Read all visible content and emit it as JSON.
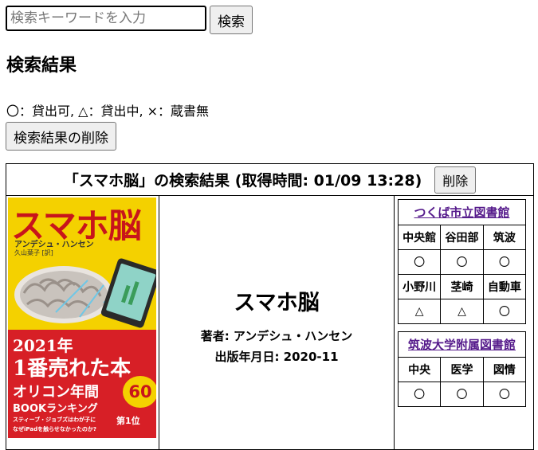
{
  "search": {
    "placeholder": "検索キーワードを入力",
    "button": "検索"
  },
  "heading": "検索結果",
  "legend": "〇：貸出可, △：貸出中, ×：蔵書無",
  "delete_all": "検索結果の削除",
  "result": {
    "header": "「スマホ脳」の検索結果 (取得時間: 01/09 13:28)",
    "delete_button": "削除",
    "book": {
      "title": "スマホ脳",
      "author": "著者: アンデシュ・ハンセン",
      "date": "出版年月日: 2020-11"
    },
    "cover": {
      "title": "スマホ脳",
      "author": "アンデシュ・ハンセン",
      "translator": "久山葉子 [訳]",
      "band_line1": "2021年",
      "band_line2": "1番売れた本",
      "band_line3": "オリコン年間",
      "band_line4": "BOOKランキング",
      "band_line5": "スティーブ・ジョブズはわが子に",
      "band_line6": "なぜiPadを触らせなかったのか?",
      "badge": "60",
      "rank": "第1位",
      "colors": {
        "background": "#f4d100",
        "band": "#d71f26",
        "title": "#c8141b"
      }
    },
    "libraries": [
      {
        "name": "つくば市立図書館",
        "rows": [
          {
            "branches": [
              "中央館",
              "谷田部",
              "筑波"
            ],
            "status": [
              "〇",
              "〇",
              "〇"
            ]
          },
          {
            "branches": [
              "小野川",
              "茎崎",
              "自動車"
            ],
            "status": [
              "△",
              "△",
              "〇"
            ]
          }
        ]
      },
      {
        "name": "筑波大学附属図書館",
        "rows": [
          {
            "branches": [
              "中央",
              "医学",
              "図情"
            ],
            "status": [
              "〇",
              "〇",
              "〇"
            ]
          }
        ]
      }
    ]
  }
}
